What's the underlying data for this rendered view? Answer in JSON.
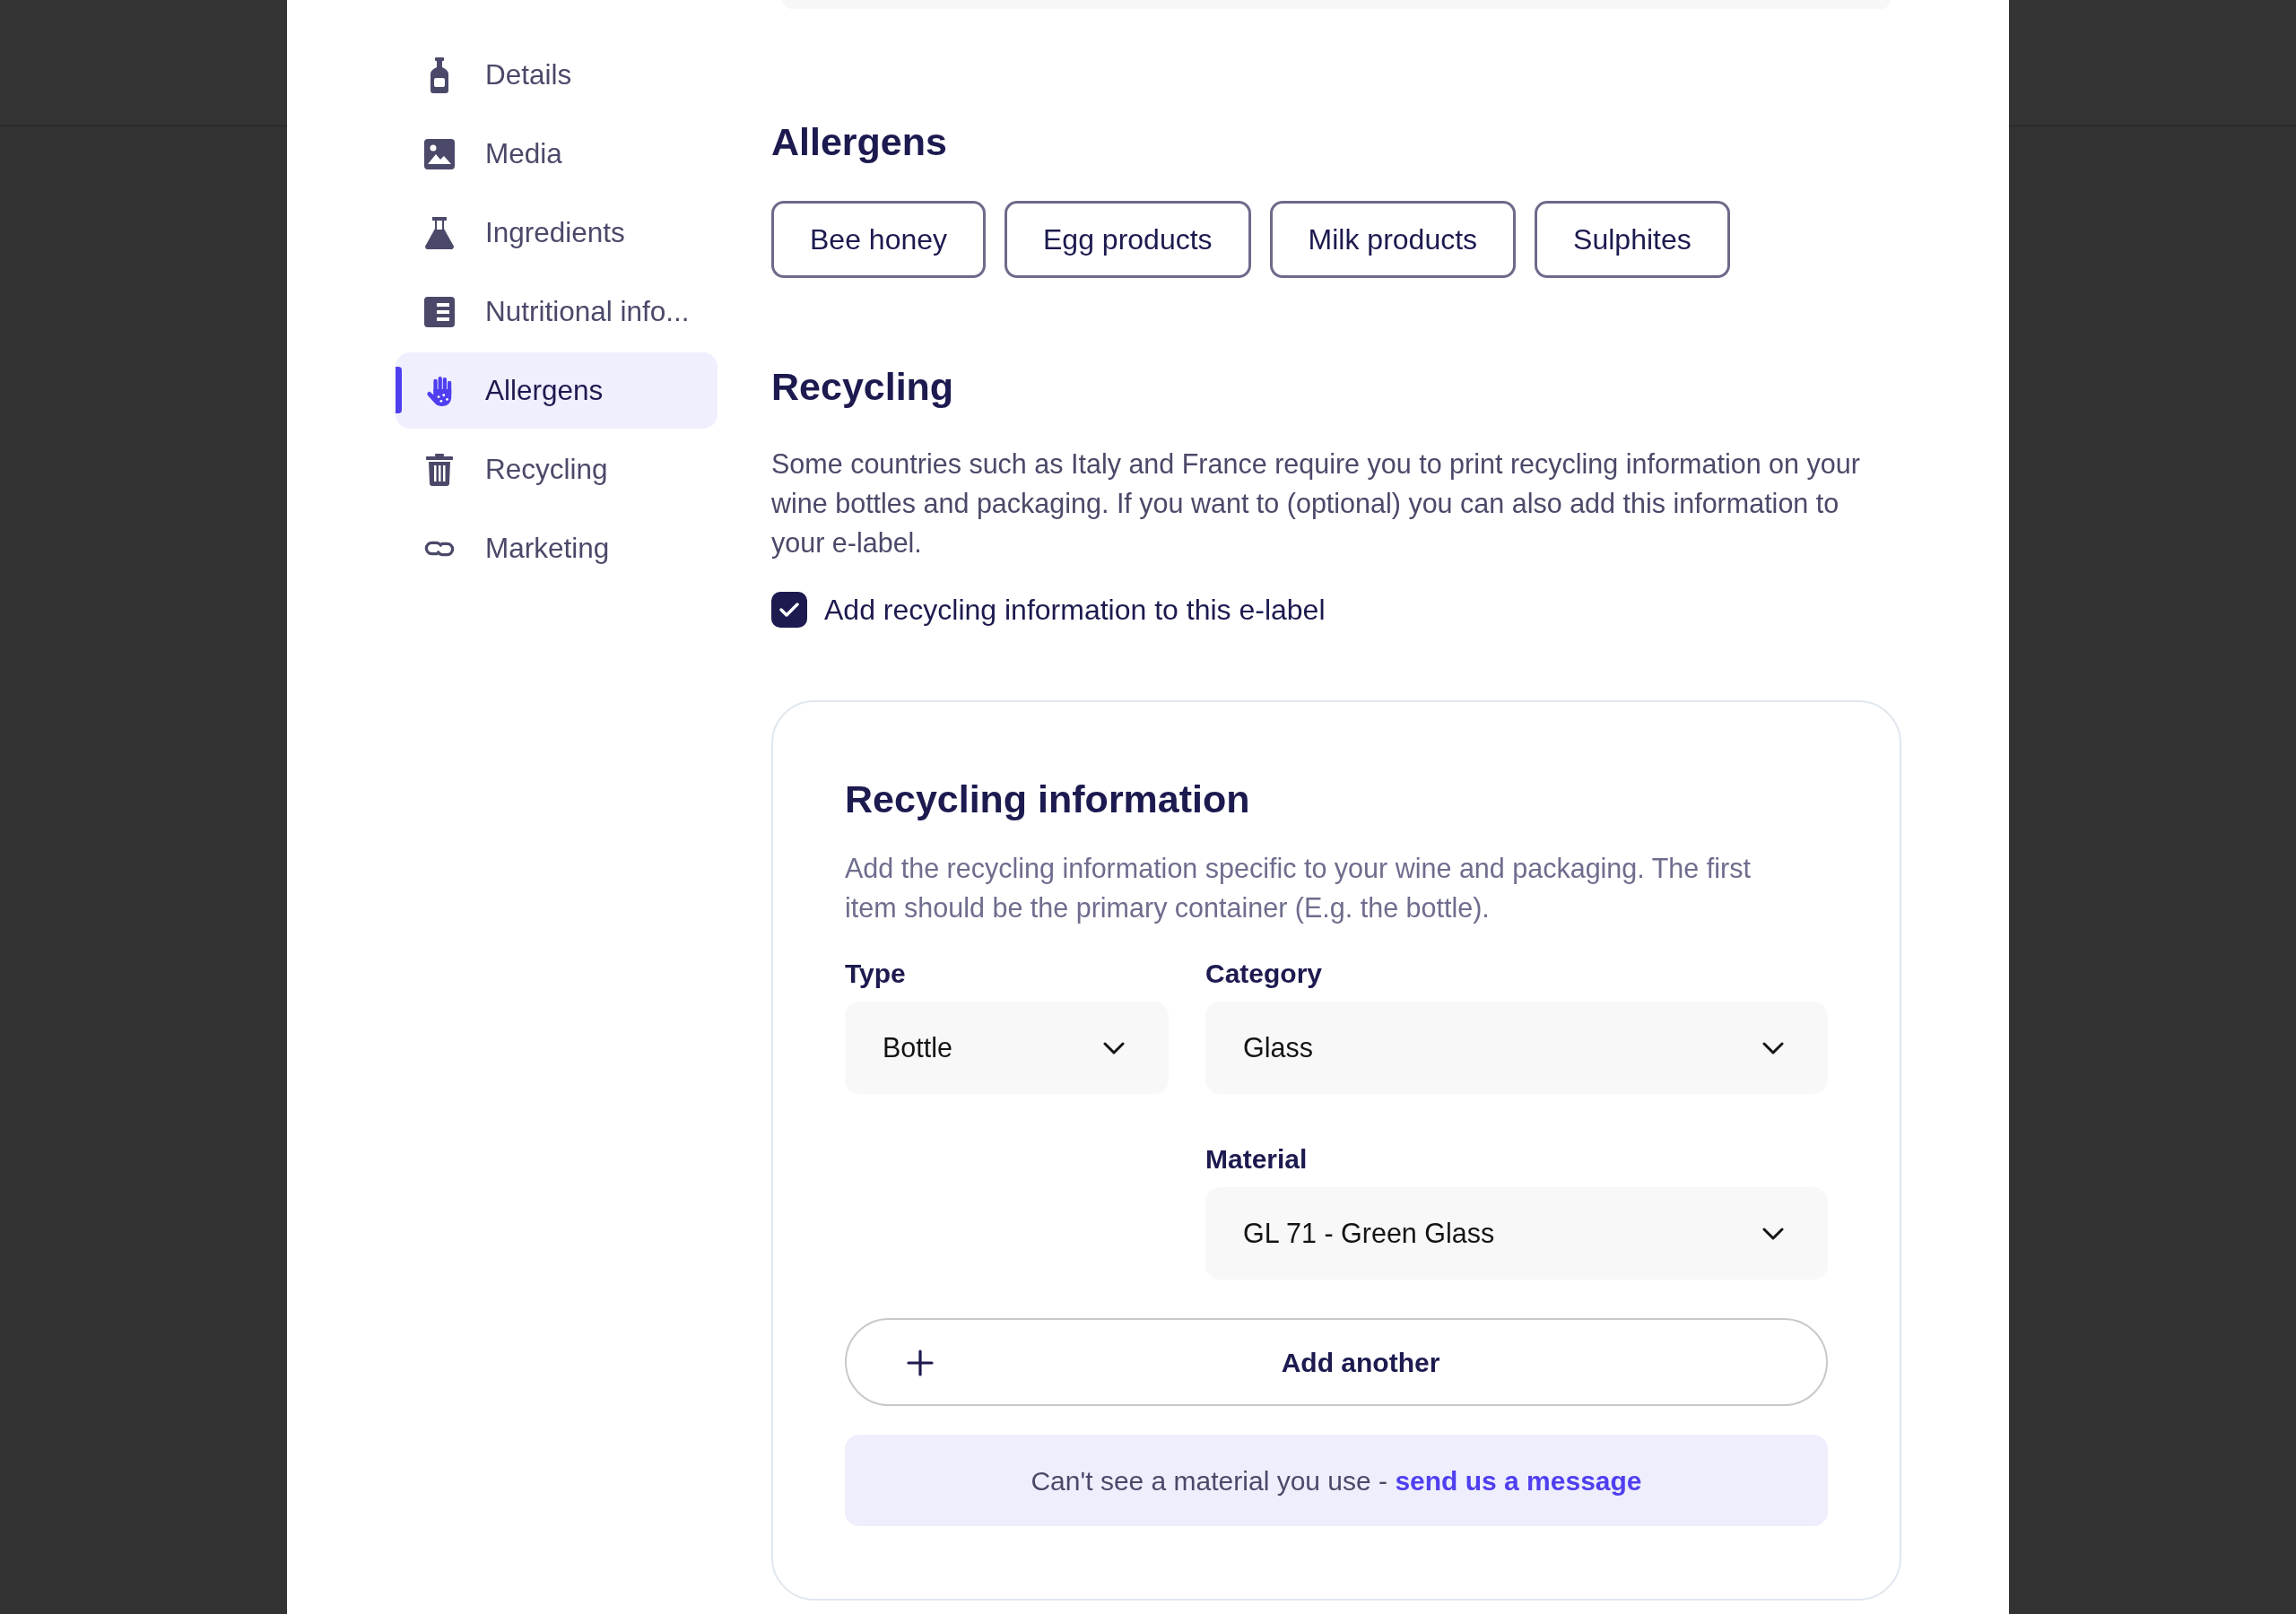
{
  "sidebar": {
    "items": [
      {
        "label": "Details",
        "selected": false
      },
      {
        "label": "Media",
        "selected": false
      },
      {
        "label": "Ingredients",
        "selected": false
      },
      {
        "label": "Nutritional info...",
        "selected": false
      },
      {
        "label": "Allergens",
        "selected": true
      },
      {
        "label": "Recycling",
        "selected": false
      },
      {
        "label": "Marketing",
        "selected": false
      }
    ]
  },
  "allergens": {
    "title": "Allergens",
    "options": [
      "Bee honey",
      "Egg products",
      "Milk products",
      "Sulphites"
    ]
  },
  "recycling": {
    "title": "Recycling",
    "description": "Some countries such as Italy and France require you to print recycling information on your wine bottles and packaging. If you want to (optional) you can also add this information to your e-label.",
    "checkbox": {
      "label": "Add recycling information to this e-label",
      "checked": true
    }
  },
  "recycling_information": {
    "title": "Recycling information",
    "description": "Add the recycling information specific to your wine and packaging. The first item should be the primary container (E.g. the bottle).",
    "fields": [
      {
        "label": "Type",
        "value": "Bottle"
      },
      {
        "label": "Category",
        "value": "Glass"
      },
      {
        "label": "Material",
        "value": "GL 71 - Green Glass"
      }
    ],
    "add_button": "Add another",
    "notice": {
      "text": "Can't see a material you use -",
      "link": "send us a message"
    }
  }
}
